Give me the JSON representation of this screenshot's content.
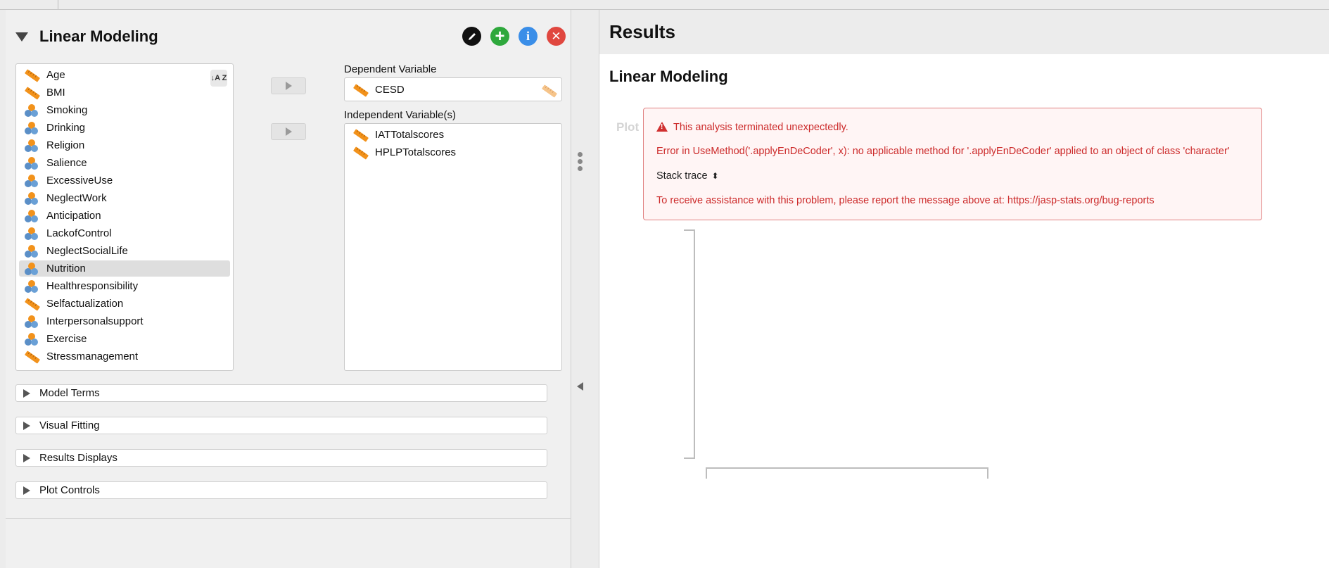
{
  "analysis": {
    "title": "Linear Modeling",
    "buttons": {
      "edit_icon": "pencil-icon",
      "add_icon": "plus-icon",
      "info_label": "i",
      "close_label": "✕"
    }
  },
  "variables": [
    {
      "label": "Age",
      "type": "scale"
    },
    {
      "label": "BMI",
      "type": "scale"
    },
    {
      "label": "Smoking",
      "type": "nominal"
    },
    {
      "label": "Drinking",
      "type": "nominal"
    },
    {
      "label": "Religion",
      "type": "nominal"
    },
    {
      "label": "Salience",
      "type": "nominal"
    },
    {
      "label": "ExcessiveUse",
      "type": "nominal"
    },
    {
      "label": "NeglectWork",
      "type": "nominal"
    },
    {
      "label": "Anticipation",
      "type": "nominal"
    },
    {
      "label": "LackofControl",
      "type": "nominal"
    },
    {
      "label": "NeglectSocialLife",
      "type": "nominal"
    },
    {
      "label": "Nutrition",
      "type": "nominal",
      "selected": true
    },
    {
      "label": "Healthresponsibility",
      "type": "nominal"
    },
    {
      "label": "Selfactualization",
      "type": "scale"
    },
    {
      "label": "Interpersonalsupport",
      "type": "nominal"
    },
    {
      "label": "Exercise",
      "type": "nominal"
    },
    {
      "label": "Stressmanagement",
      "type": "scale"
    }
  ],
  "sort_label": "↓A Z",
  "dependent": {
    "label": "Dependent Variable",
    "value": "CESD"
  },
  "independent": {
    "label": "Independent Variable(s)",
    "items": [
      "IATTotalscores",
      "HPLPTotalscores"
    ]
  },
  "sections": [
    {
      "label": "Model Terms"
    },
    {
      "label": "Visual Fitting"
    },
    {
      "label": "Results Displays"
    },
    {
      "label": "Plot Controls"
    }
  ],
  "results": {
    "heading": "Results",
    "subheading": "Linear Modeling",
    "plot_label": "Plot",
    "error": {
      "title": "This analysis terminated unexpectedly.",
      "message": "Error in UseMethod('.applyEnDeCoder', x): no applicable method for '.applyEnDeCoder' applied to an object of class 'character'",
      "stack_trace": "Stack trace",
      "assistance": "To receive assistance with this problem, please report the message above at: https://jasp-stats.org/bug-reports"
    }
  },
  "colors": {
    "scale_icon": "#f2921b",
    "error_text": "#cc2a2a",
    "error_border": "#e08080",
    "add_button": "#2ea83c",
    "info_button": "#3a8ee8",
    "close_button": "#e0473f"
  }
}
